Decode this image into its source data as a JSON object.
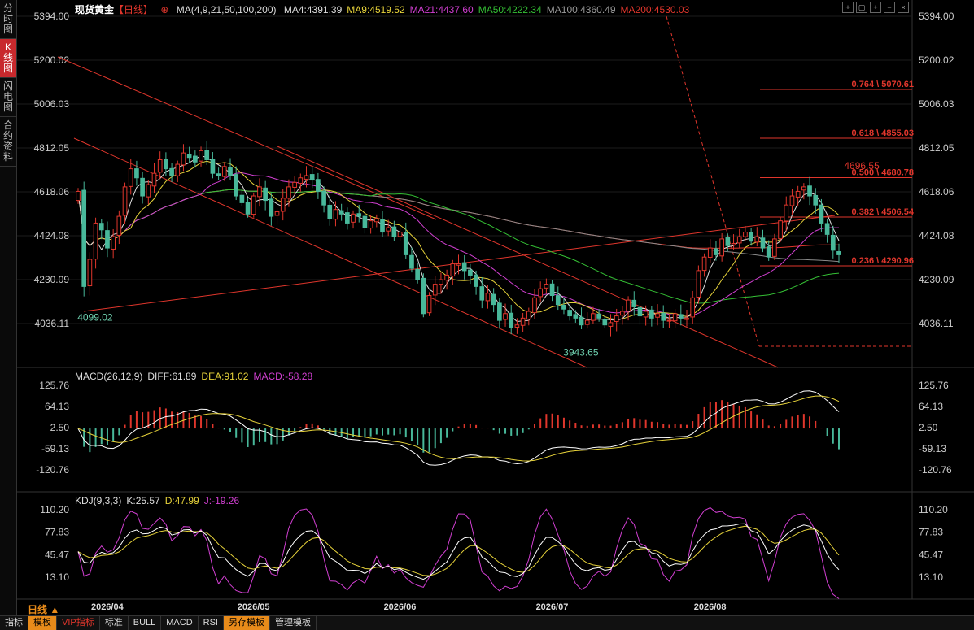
{
  "sidebar": {
    "items": [
      {
        "label": "分时图",
        "active": false
      },
      {
        "label": "K线图",
        "active": true
      },
      {
        "label": "闪电图",
        "active": false
      },
      {
        "label": "合约资料",
        "active": false
      }
    ]
  },
  "header": {
    "instrument": "现货黄金",
    "period": "【日线】",
    "ma_params": "MA(4,9,21,50,100,200)",
    "ma_values": [
      {
        "text": "MA4:4391.39",
        "color": "#dddddd"
      },
      {
        "text": "MA9:4519.52",
        "color": "#e6d23a"
      },
      {
        "text": "MA21:4437.60",
        "color": "#d13fd1"
      },
      {
        "text": "MA50:4222.34",
        "color": "#35c135"
      },
      {
        "text": "MA100:4360.49",
        "color": "#9a9a9a"
      },
      {
        "text": "MA200:4530.03",
        "color": "#e0362c"
      }
    ]
  },
  "macd_legend": [
    {
      "text": "MACD(26,12,9)",
      "color": "#dddddd"
    },
    {
      "text": "DIFF:61.89",
      "color": "#dddddd"
    },
    {
      "text": "DEA:91.02",
      "color": "#e6d23a"
    },
    {
      "text": "MACD:-58.28",
      "color": "#d13fd1"
    }
  ],
  "kdj_legend": [
    {
      "text": "KDJ(9,3,3)",
      "color": "#dddddd"
    },
    {
      "text": "K:25.57",
      "color": "#dddddd"
    },
    {
      "text": "D:47.99",
      "color": "#e6d23a"
    },
    {
      "text": "J:-19.26",
      "color": "#d13fd1"
    }
  ],
  "toolbar": {
    "period_label": "日线 ▲",
    "buttons": [
      "指标",
      "模板",
      "VIP指标",
      "标准",
      "BULL",
      "MACD",
      "RSI",
      "另存模板",
      "管理模板"
    ]
  },
  "chart_data": {
    "type": "candlestick",
    "price_axis": {
      "ticks": [
        5394.0,
        5200.02,
        5006.03,
        4812.05,
        4618.06,
        4424.08,
        4230.09,
        4036.11
      ]
    },
    "macd_axis": {
      "ticks": [
        125.76,
        64.13,
        2.5,
        -59.13,
        -120.76
      ]
    },
    "kdj_axis": {
      "ticks": [
        110.2,
        77.83,
        45.47,
        13.1
      ]
    },
    "x_labels": [
      "2026/04",
      "2026/05",
      "2026/06",
      "2026/07",
      "2026/08"
    ],
    "x_label_index": [
      5,
      30,
      55,
      81,
      108
    ],
    "annotations": [
      {
        "text": "4099.02",
        "index": 1,
        "price": 4099.02,
        "color": "#6fd1b0"
      },
      {
        "text": "3943.65",
        "index": 84,
        "price": 3943.65,
        "color": "#6fd1b0"
      },
      {
        "text": "4696.55",
        "index": 132,
        "price": 4696.55,
        "color": "#e0362c"
      }
    ],
    "fib_levels": [
      {
        "ratio": "0.764",
        "price": 5070.61,
        "text": "0.764 \\ 5070.61"
      },
      {
        "ratio": "0.618",
        "price": 4855.03,
        "text": "0.618 \\ 4855.03"
      },
      {
        "ratio": "0.500",
        "price": 4680.78,
        "text": "0.500 \\ 4680.78"
      },
      {
        "ratio": "0.382",
        "price": 4506.54,
        "text": "0.382 \\ 4506.54"
      },
      {
        "ratio": "0.236",
        "price": 4290.96,
        "text": "0.236 \\ 4290.96"
      }
    ],
    "closes": [
      4620,
      4200,
      4320,
      4480,
      4450,
      4370,
      4420,
      4510,
      4640,
      4720,
      4680,
      4600,
      4650,
      4700,
      4760,
      4720,
      4690,
      4740,
      4790,
      4770,
      4750,
      4800,
      4760,
      4700,
      4690,
      4730,
      4690,
      4600,
      4570,
      4520,
      4600,
      4640,
      4580,
      4510,
      4530,
      4590,
      4640,
      4660,
      4680,
      4690,
      4670,
      4620,
      4560,
      4500,
      4540,
      4520,
      4480,
      4520,
      4510,
      4460,
      4490,
      4500,
      4440,
      4460,
      4420,
      4440,
      4340,
      4280,
      4230,
      4080,
      4160,
      4210,
      4230,
      4250,
      4300,
      4300,
      4270,
      4250,
      4200,
      4140,
      4170,
      4120,
      4050,
      4080,
      4020,
      4030,
      4060,
      4090,
      4150,
      4190,
      4210,
      4160,
      4120,
      4100,
      4070,
      4060,
      4030,
      4050,
      4080,
      4060,
      4030,
      4040,
      4070,
      4090,
      4140,
      4110,
      4070,
      4090,
      4060,
      4080,
      4050,
      4050,
      4080,
      4060,
      4060,
      4150,
      4270,
      4330,
      4370,
      4340,
      4410,
      4380,
      4390,
      4420,
      4440,
      4400,
      4420,
      4370,
      4330,
      4410,
      4490,
      4560,
      4600,
      4620,
      4640,
      4600,
      4560,
      4480,
      4430,
      4360,
      4340
    ]
  }
}
